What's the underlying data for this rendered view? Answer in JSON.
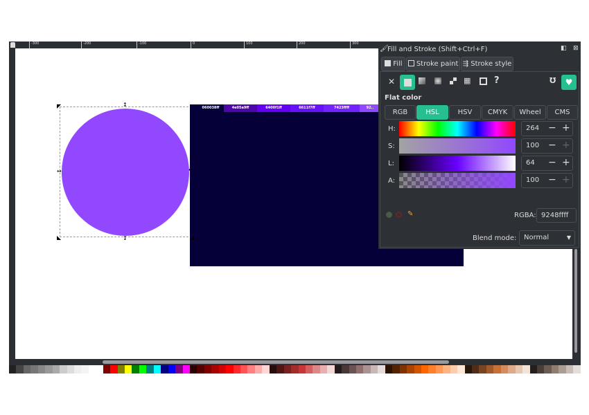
{
  "ruler": {
    "labels": [
      "-300",
      "-200",
      "-100",
      "0",
      "100",
      "200",
      "300"
    ]
  },
  "canvas": {
    "circle_fill": "#9248ff",
    "rect_fill": "#060038",
    "swatches": [
      {
        "label": "060038ff",
        "color": "#060038"
      },
      {
        "label": "4e05a9ff",
        "color": "#4e05a9"
      },
      {
        "label": "6400f1ff",
        "color": "#6400f1"
      },
      {
        "label": "6611f7ff",
        "color": "#6611f7"
      },
      {
        "label": "7423ffff",
        "color": "#7423ff"
      },
      {
        "label": "92..",
        "color": "#9248ff"
      }
    ]
  },
  "panel": {
    "title": "Fill and Stroke (Shift+Ctrl+F)",
    "tabs": [
      {
        "label": "Fill"
      },
      {
        "label": "Stroke paint"
      },
      {
        "label": "Stroke style"
      }
    ],
    "paint_types": [
      "no-paint-icon",
      "flat-color-icon",
      "linear-gradient-icon",
      "radial-gradient-icon",
      "mesh-gradient-icon",
      "pattern-icon",
      "swatch-icon",
      "unset-icon"
    ],
    "section_title": "Flat color",
    "modes": [
      "RGB",
      "HSL",
      "HSV",
      "CMYK",
      "Wheel",
      "CMS"
    ],
    "active_mode": "HSL",
    "sliders": [
      {
        "label": "H:",
        "value": "264"
      },
      {
        "label": "S:",
        "value": "100"
      },
      {
        "label": "L:",
        "value": "64"
      },
      {
        "label": "A:",
        "value": "100"
      }
    ],
    "rgba_label": "RGBA:",
    "rgba_value": "9248ffff",
    "blend_label": "Blend mode:",
    "blend_value": "Normal",
    "accent": "#26bf90"
  }
}
